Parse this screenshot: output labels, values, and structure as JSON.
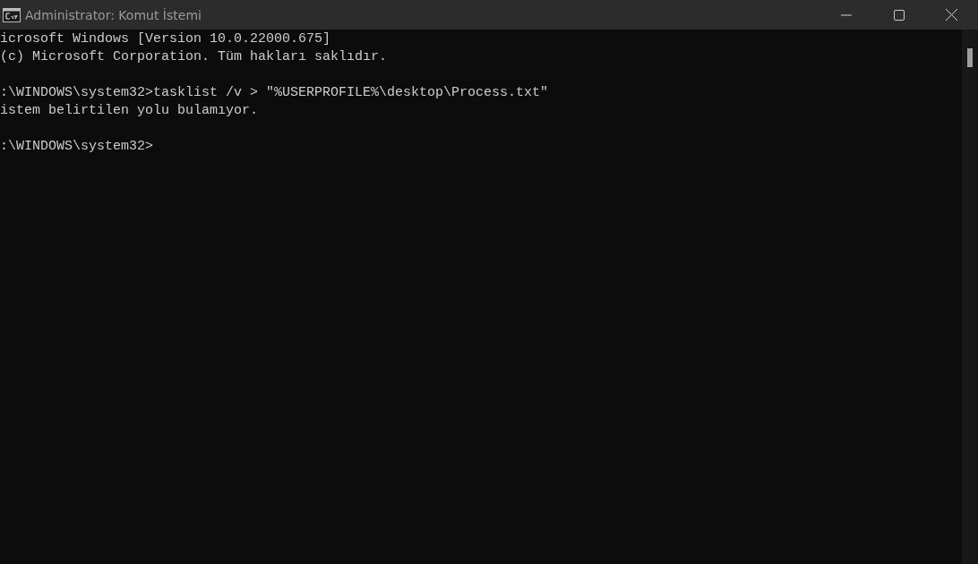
{
  "window": {
    "title": "Administrator: Komut İstemi"
  },
  "console": {
    "blocks": [
      [
        "icrosoft Windows [Version 10.0.22000.675]",
        "(c) Microsoft Corporation. Tüm hakları saklıdır."
      ],
      [
        ":\\WINDOWS\\system32>tasklist /v > \"%USERPROFILE%\\desktop\\Process.txt\"",
        "istem belirtilen yolu bulamıyor."
      ],
      [
        ":\\WINDOWS\\system32>"
      ]
    ]
  }
}
